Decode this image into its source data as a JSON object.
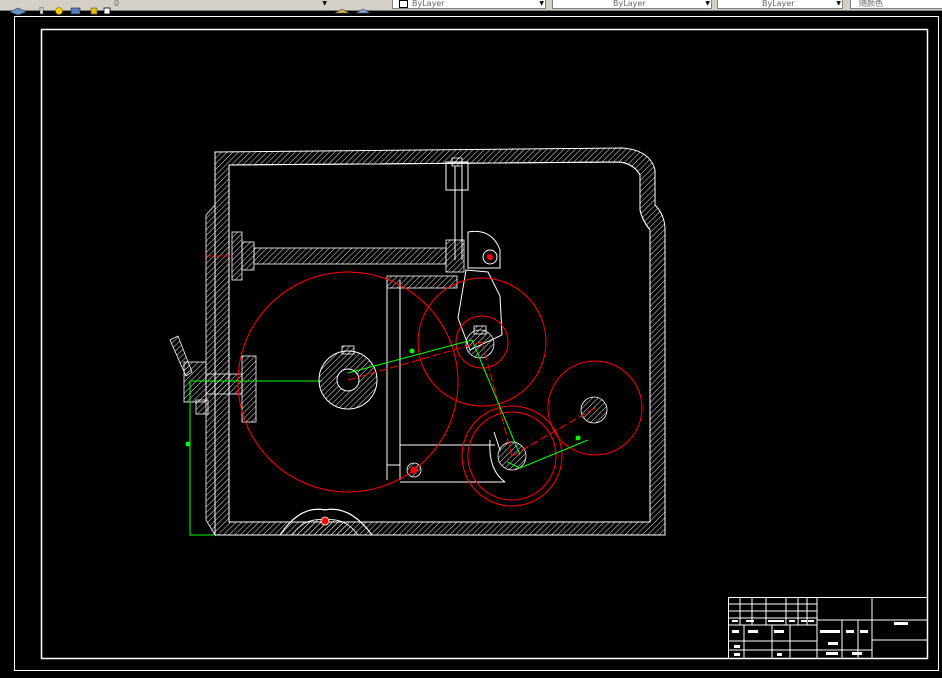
{
  "toolbar": {
    "layer_name": "0",
    "color_combo": "ByLayer",
    "linetype_combo": "ByLayer",
    "lineweight_combo": "ByLayer",
    "plotstyle_combo": "随颜色"
  },
  "colors": {
    "background": "#000000",
    "frame": "#ffffff",
    "red_lines": "#ff0000",
    "green_lines": "#00ff00"
  }
}
